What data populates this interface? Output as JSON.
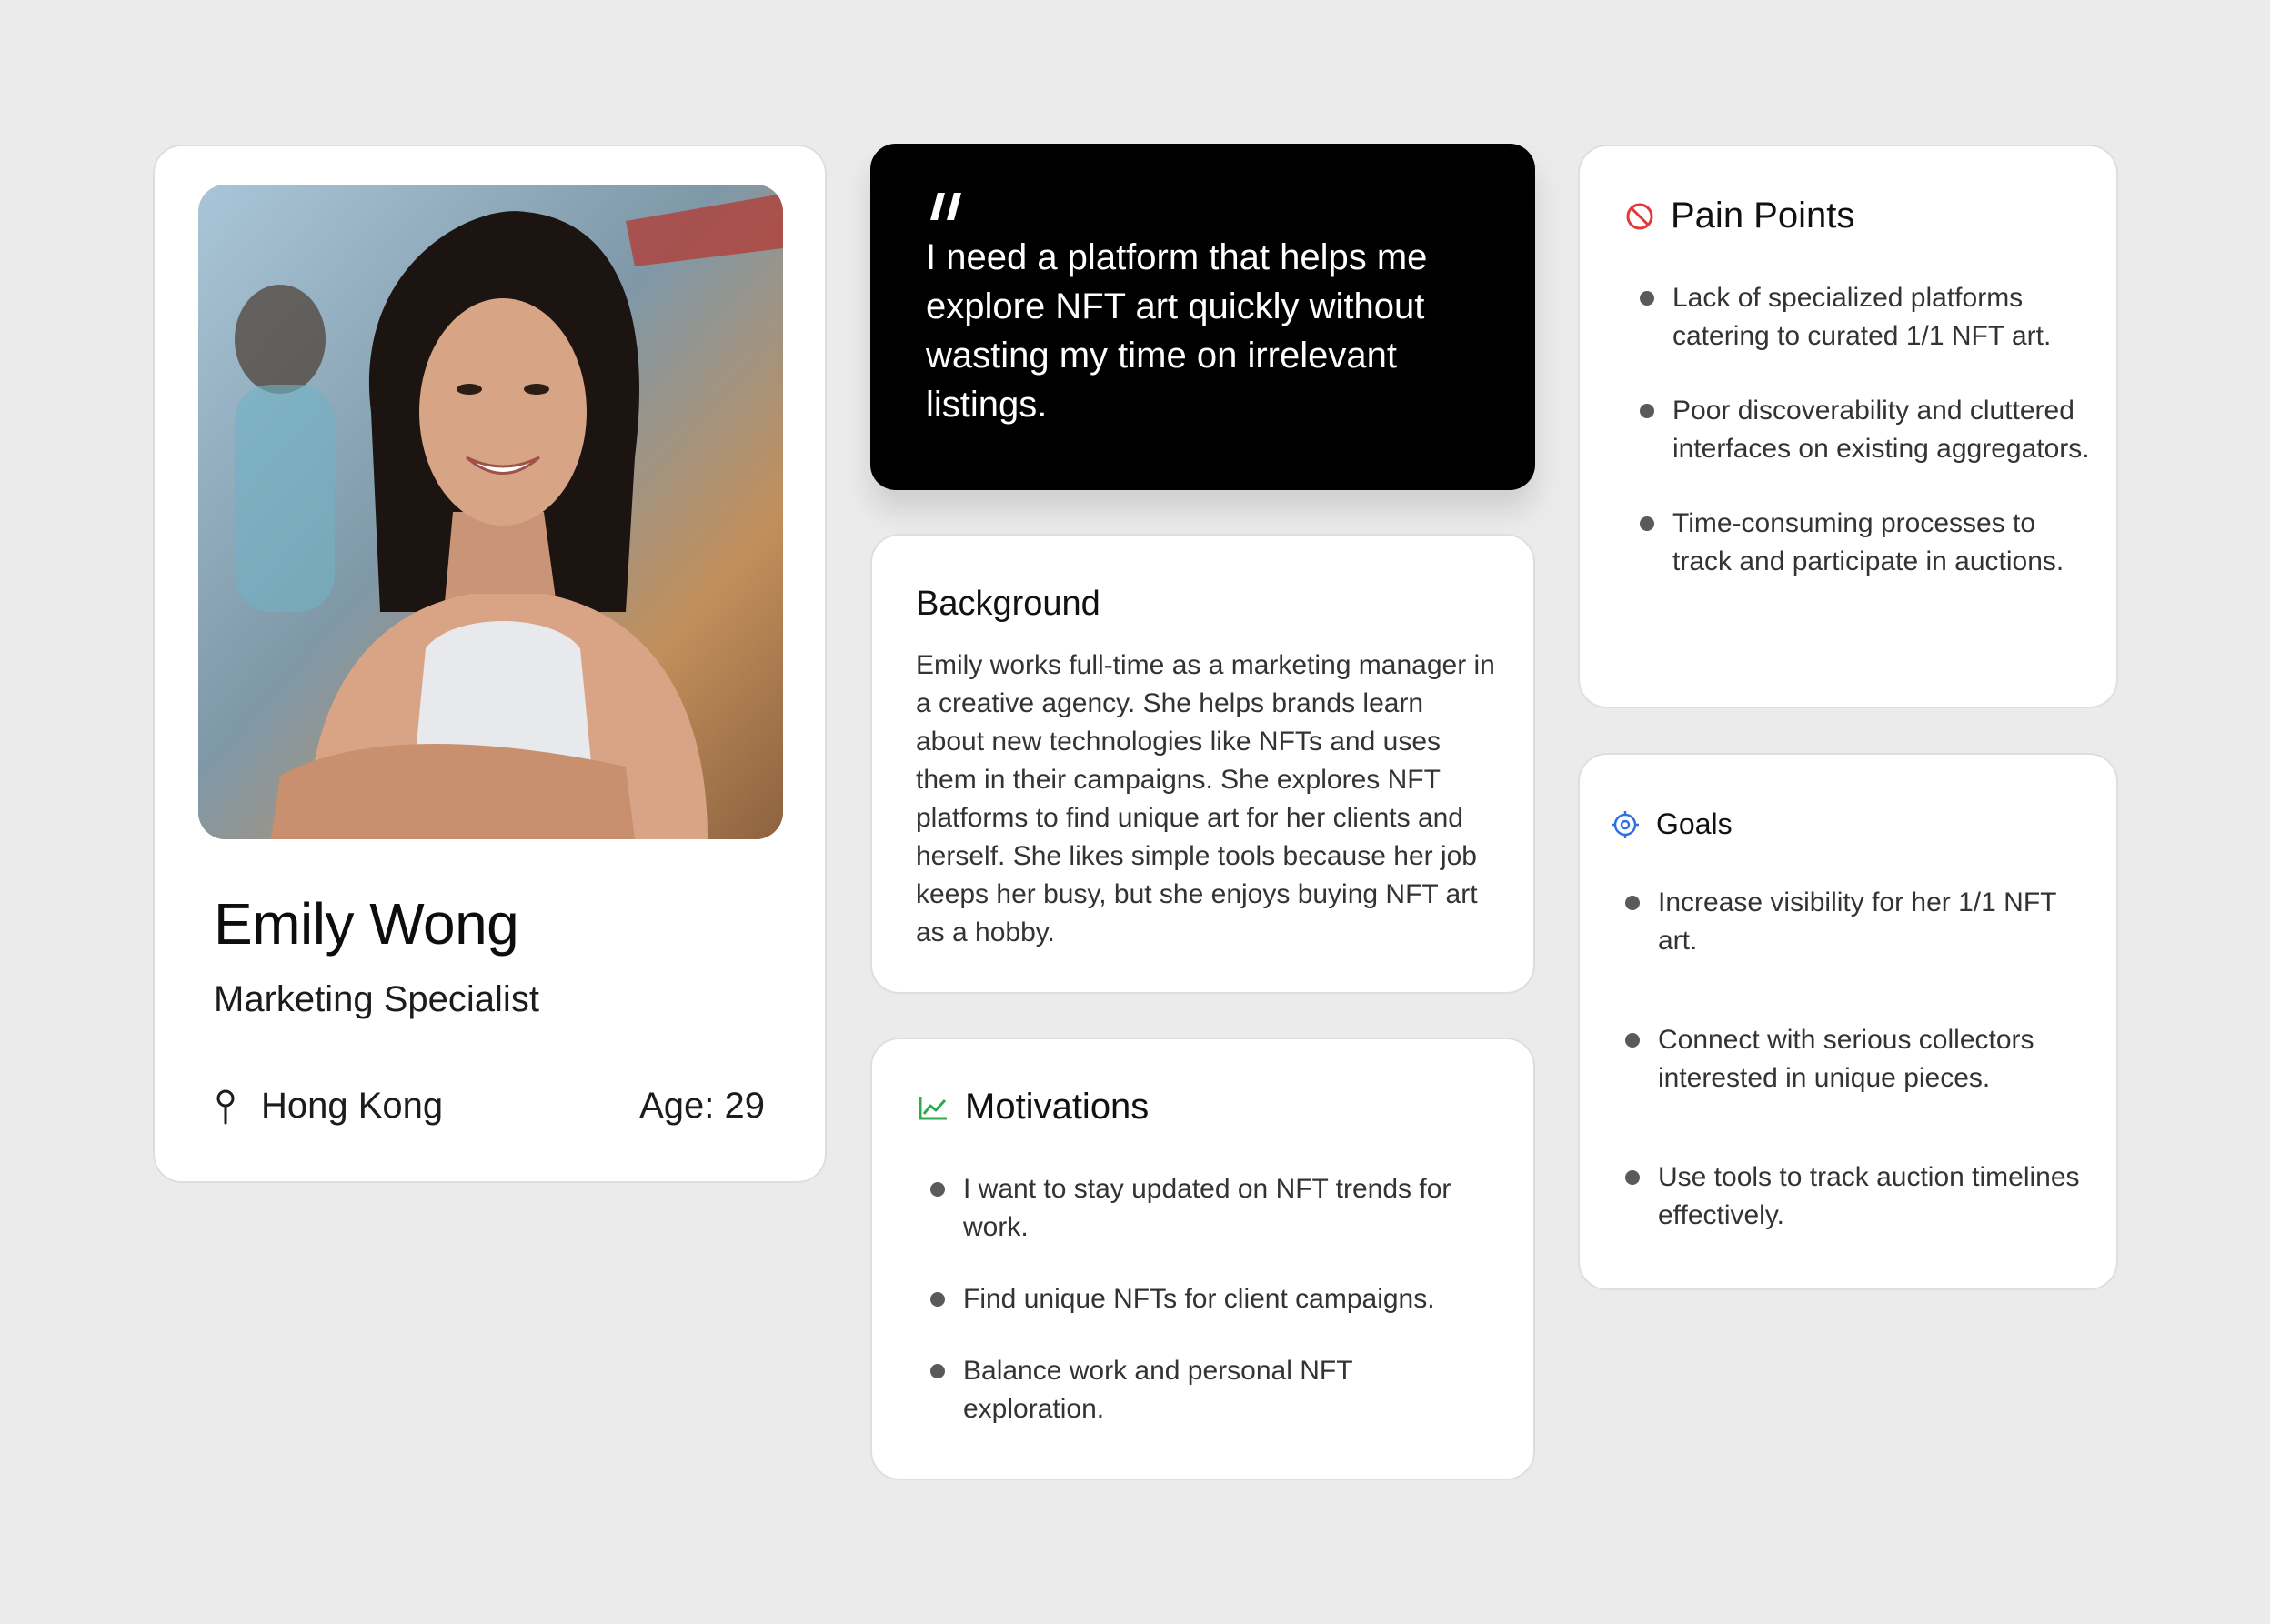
{
  "profile": {
    "name": "Emily Wong",
    "role": "Marketing Specialist",
    "location": "Hong Kong",
    "age": "Age: 29",
    "photo_icon": "portrait-photo",
    "location_icon": "location-pin-icon"
  },
  "quote": {
    "icon": "quote-mark-icon",
    "text": "I need a platform that helps me explore NFT art quickly without wasting my time on irrelevant listings."
  },
  "background": {
    "title": "Background",
    "text": "Emily works full-time as a marketing manager in a creative agency. She helps brands learn about new technologies like NFTs and uses them in their campaigns. She explores NFT platforms to find unique art for her clients and herself. She likes simple tools because her job keeps her busy, but she enjoys buying NFT art as a hobby."
  },
  "motivations": {
    "title": "Motivations",
    "icon": "trend-chart-icon",
    "icon_color": "#2fa84f",
    "items": [
      "I want to stay updated on NFT trends for work.",
      "Find unique NFTs for client campaigns.",
      "Balance work and personal NFT exploration."
    ]
  },
  "pain_points": {
    "title": "Pain Points",
    "icon": "prohibited-icon",
    "icon_color": "#e03a3a",
    "items": [
      "Lack of specialized platforms catering to curated 1/1 NFT art.",
      "Poor discoverability and cluttered interfaces on existing aggregators.",
      "Time-consuming processes to track and participate in auctions."
    ]
  },
  "goals": {
    "title": "Goals",
    "icon": "target-icon",
    "icon_color": "#2f6fe0",
    "items": [
      "Increase visibility for her 1/1 NFT art.",
      "Connect with serious collectors interested in unique pieces.",
      "Use tools to track auction timelines effectively."
    ]
  },
  "colors": {
    "page_background": "#ebebeb",
    "card_background": "#ffffff",
    "quote_background": "#000000"
  }
}
